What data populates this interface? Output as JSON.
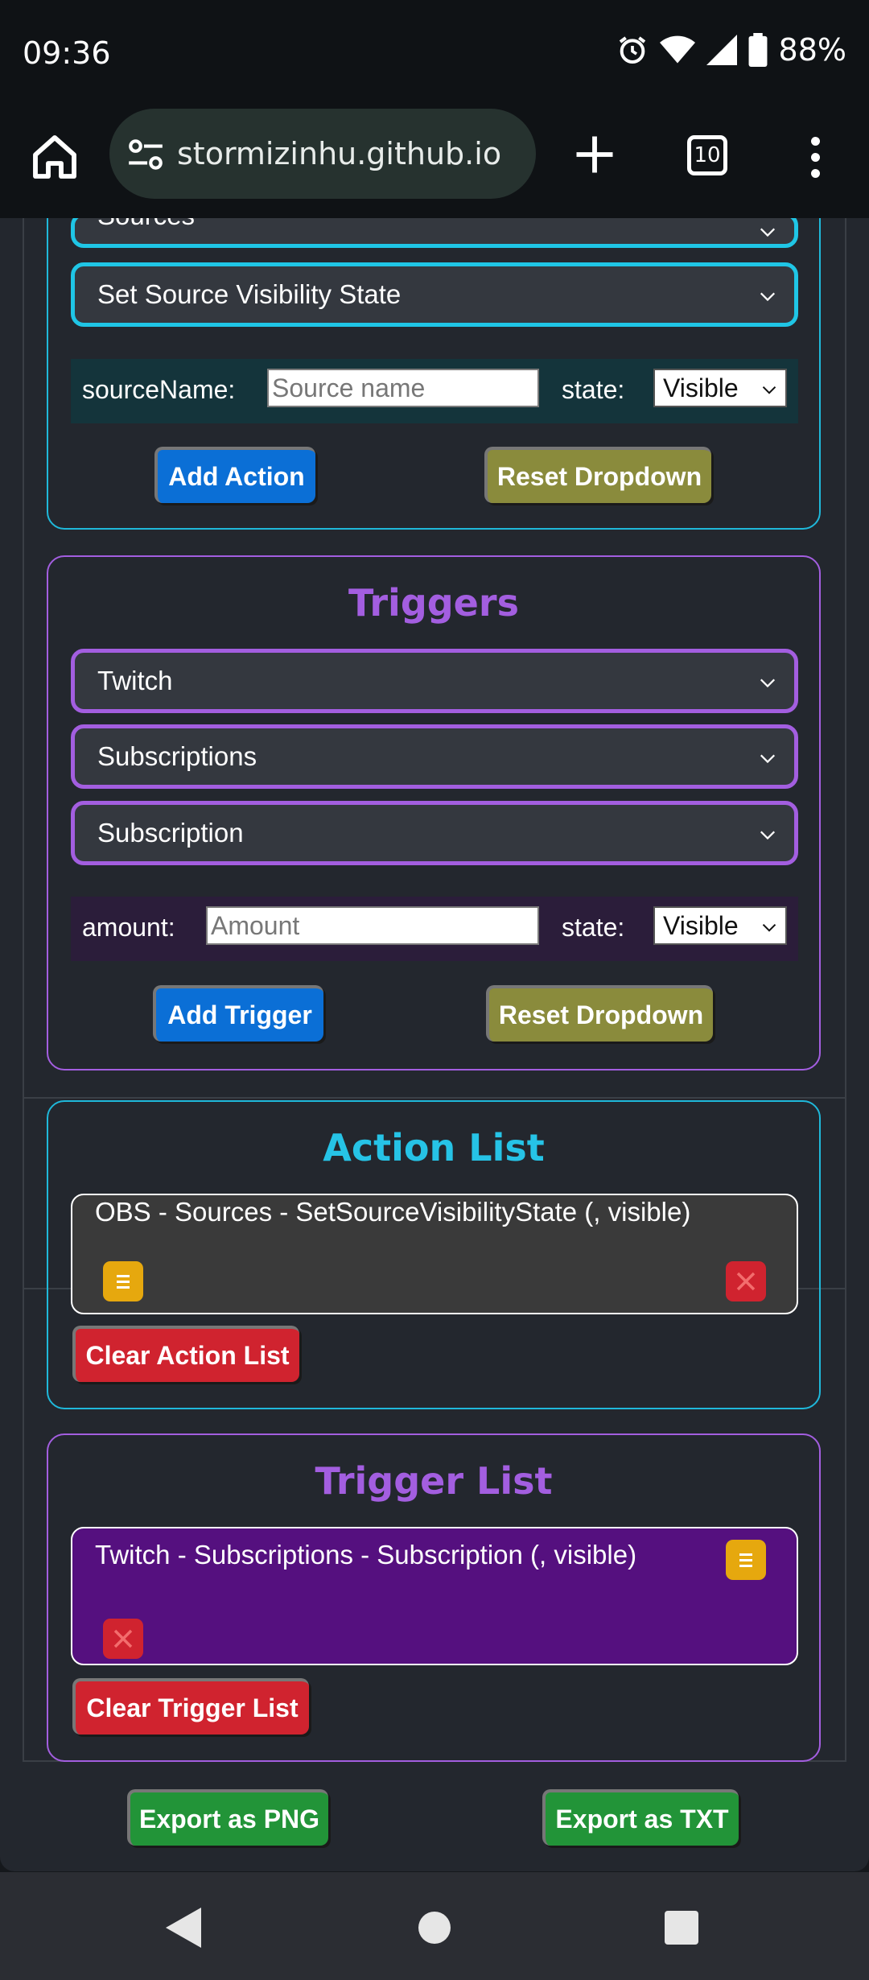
{
  "status": {
    "time": "09:36",
    "battery": "88%"
  },
  "browser": {
    "url": "stormizinhu.github.io",
    "tab_count": "10"
  },
  "actions": {
    "category_select": "Sources",
    "action_select": "Set Source Visibility State",
    "param_source_label": "sourceName:",
    "param_source_placeholder": "Source name",
    "param_state_label": "state:",
    "param_state_value": "Visible",
    "add_button": "Add Action",
    "reset_button": "Reset Dropdown"
  },
  "triggers": {
    "title": "Triggers",
    "platform_select": "Twitch",
    "category_select": "Subscriptions",
    "trigger_select": "Subscription",
    "param_amount_label": "amount:",
    "param_amount_placeholder": "Amount",
    "param_state_label": "state:",
    "param_state_value": "Visible",
    "add_button": "Add Trigger",
    "reset_button": "Reset Dropdown"
  },
  "action_list": {
    "title": "Action List",
    "items": [
      {
        "text": "OBS - Sources - SetSourceVisibilityState (, visible)"
      }
    ],
    "clear_button": "Clear Action List"
  },
  "trigger_list": {
    "title": "Trigger List",
    "items": [
      {
        "text": "Twitch - Subscriptions - Subscription (, visible)"
      }
    ],
    "clear_button": "Clear Trigger List"
  },
  "export": {
    "png_button": "Export as PNG",
    "txt_button": "Export as TXT"
  },
  "colors": {
    "cyan": "#1fc6e6",
    "purple": "#a35ee0",
    "blue_button": "#0b6fd6",
    "olive_button": "#8a8b3c",
    "red_button": "#d0232f",
    "green_button": "#229438",
    "drag_handle": "#e6a80e",
    "trigger_item_bg": "#55107f"
  }
}
